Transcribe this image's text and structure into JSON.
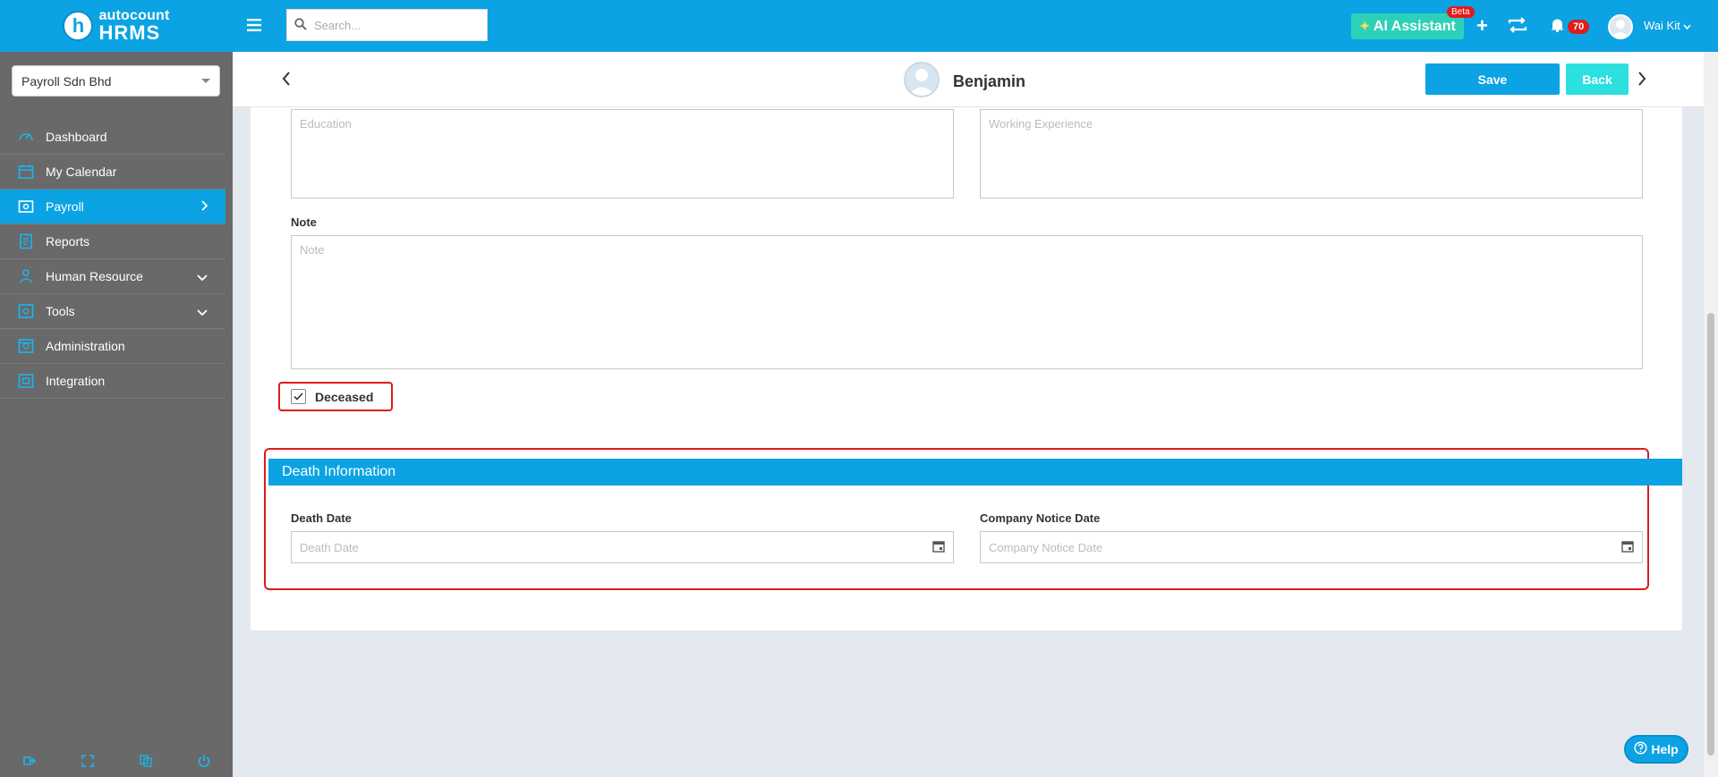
{
  "app": {
    "logo_top": "autocount",
    "logo_bottom": "HRMS",
    "logo_letter": "h"
  },
  "company": {
    "selected": "Payroll Sdn Bhd"
  },
  "sidebar": {
    "items": [
      {
        "label": "Dashboard",
        "icon": "dashboard-icon",
        "active": false,
        "expand": ""
      },
      {
        "label": "My Calendar",
        "icon": "calendar-icon",
        "active": false,
        "expand": ""
      },
      {
        "label": "Payroll",
        "icon": "payroll-icon",
        "active": true,
        "expand": "chevron-right"
      },
      {
        "label": "Reports",
        "icon": "reports-icon",
        "active": false,
        "expand": ""
      },
      {
        "label": "Human Resource",
        "icon": "human-resource-icon",
        "active": false,
        "expand": "chevron-down"
      },
      {
        "label": "Tools",
        "icon": "tools-icon",
        "active": false,
        "expand": "chevron-down"
      },
      {
        "label": "Administration",
        "icon": "administration-icon",
        "active": false,
        "expand": ""
      },
      {
        "label": "Integration",
        "icon": "integration-icon",
        "active": false,
        "expand": ""
      }
    ]
  },
  "topbar": {
    "search_placeholder": "Search...",
    "ai_label": "AI Assistant",
    "beta_label": "Beta",
    "notification_count": "70",
    "user_name": "Wai Kit"
  },
  "header": {
    "employee_name": "Benjamin",
    "save_label": "Save",
    "back_label": "Back"
  },
  "form": {
    "education_placeholder": "Education",
    "working_experience_placeholder": "Working Experience",
    "note_label": "Note",
    "note_placeholder": "Note",
    "deceased_label": "Deceased",
    "deceased_checked": true,
    "death_section_title": "Death Information",
    "death_date_label": "Death Date",
    "death_date_placeholder": "Death Date",
    "company_notice_label": "Company Notice Date",
    "company_notice_placeholder": "Company Notice Date"
  },
  "help": {
    "label": "Help"
  },
  "colors": {
    "primary": "#0ba3e3",
    "sidebar_bg": "#696969",
    "highlight": "#e01b1b",
    "ai_button": "#2dd1b8",
    "back_button": "#2de0e0"
  }
}
